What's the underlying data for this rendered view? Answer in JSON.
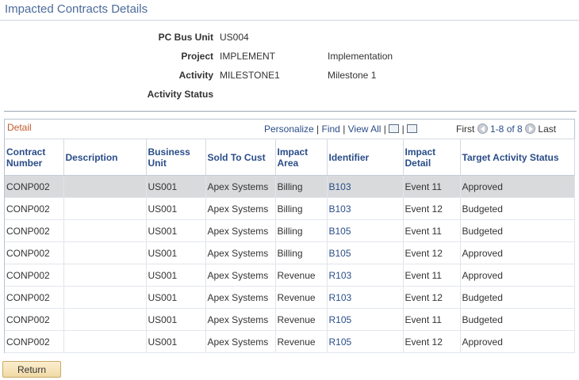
{
  "page": {
    "title": "Impacted Contracts Details"
  },
  "fields": [
    {
      "label": "PC Bus Unit",
      "value": "US004",
      "desc": ""
    },
    {
      "label": "Project",
      "value": "IMPLEMENT",
      "desc": "Implementation"
    },
    {
      "label": "Activity",
      "value": "MILESTONE1",
      "desc": "Milestone 1"
    },
    {
      "label": "Activity Status",
      "value": "",
      "desc": ""
    }
  ],
  "grid": {
    "caption": "Detail",
    "personalize": "Personalize",
    "find": "Find",
    "view_all": "View All",
    "first": "First",
    "range": "1-8 of 8",
    "last": "Last",
    "columns": [
      "Contract Number",
      "Description",
      "Business Unit",
      "Sold To Cust",
      "Impact Area",
      "Identifier",
      "Impact Detail",
      "Target Activity Status"
    ],
    "rows": [
      [
        "CONP002",
        "",
        "US001",
        "Apex Systems",
        "Billing",
        "B103",
        "Event 11",
        "Approved"
      ],
      [
        "CONP002",
        "",
        "US001",
        "Apex Systems",
        "Billing",
        "B103",
        "Event 12",
        "Budgeted"
      ],
      [
        "CONP002",
        "",
        "US001",
        "Apex Systems",
        "Billing",
        "B105",
        "Event 11",
        "Budgeted"
      ],
      [
        "CONP002",
        "",
        "US001",
        "Apex Systems",
        "Billing",
        "B105",
        "Event 12",
        "Approved"
      ],
      [
        "CONP002",
        "",
        "US001",
        "Apex Systems",
        "Revenue",
        "R103",
        "Event 11",
        "Approved"
      ],
      [
        "CONP002",
        "",
        "US001",
        "Apex Systems",
        "Revenue",
        "R103",
        "Event 12",
        "Budgeted"
      ],
      [
        "CONP002",
        "",
        "US001",
        "Apex Systems",
        "Revenue",
        "R105",
        "Event 11",
        "Budgeted"
      ],
      [
        "CONP002",
        "",
        "US001",
        "Apex Systems",
        "Revenue",
        "R105",
        "Event 12",
        "Approved"
      ]
    ]
  },
  "buttons": {
    "return": "Return"
  },
  "icons": {
    "zoom": "zoom-icon",
    "download": "download-grid-icon",
    "prev": "previous-arrow-icon",
    "next": "next-arrow-icon"
  },
  "colors": {
    "title": "#4c6b9b",
    "link": "#2a4d88",
    "caption": "#c25b2b",
    "selected_row": "#d8dadc"
  }
}
